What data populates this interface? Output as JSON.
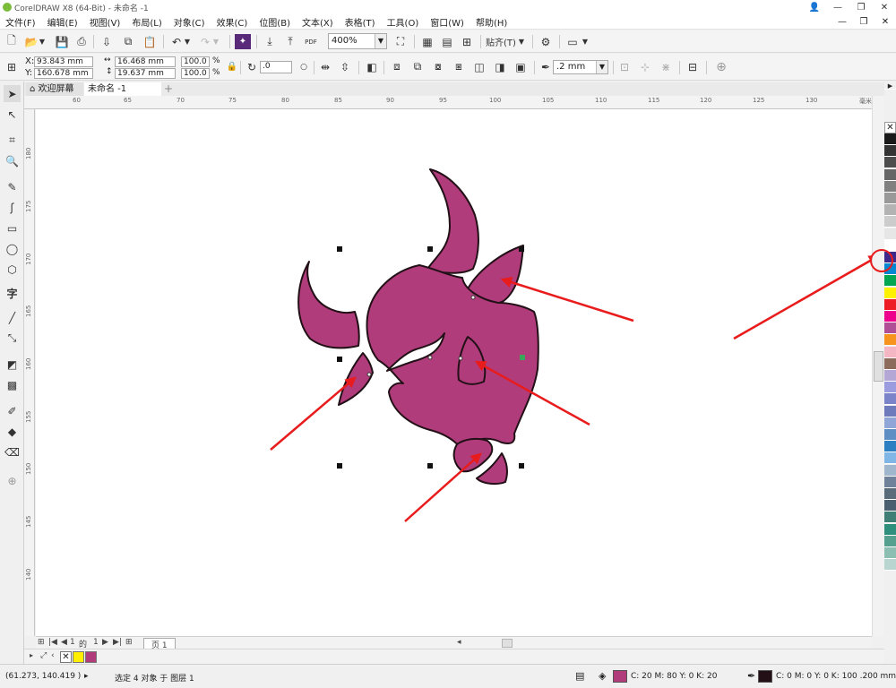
{
  "window": {
    "title": "CorelDRAW X8 (64-Bit) - 未命名 -1"
  },
  "menu": {
    "items": [
      "文件(F)",
      "编辑(E)",
      "视图(V)",
      "布局(L)",
      "对象(C)",
      "效果(C)",
      "位图(B)",
      "文本(X)",
      "表格(T)",
      "工具(O)",
      "窗口(W)",
      "帮助(H)"
    ]
  },
  "toolbar": {
    "zoom": "400%",
    "snap_label": "贴齐(T)",
    "pdf_label": "PDF"
  },
  "propbar": {
    "x_label": "X:",
    "x_value": "93.843 mm",
    "y_label": "Y:",
    "y_value": "160.678 mm",
    "width_value": "16.468 mm",
    "height_value": "19.637 mm",
    "scale_w": "100.0",
    "scale_h": "100.0",
    "percent": "%",
    "angle": ".0",
    "outline_width": ".2 mm"
  },
  "tabs": {
    "welcome": "欢迎屏幕",
    "document": "未命名 -1"
  },
  "ruler": {
    "h_labels": [
      "60",
      "65",
      "70",
      "75",
      "80",
      "85",
      "90",
      "95",
      "100",
      "105",
      "110",
      "115",
      "120",
      "125",
      "130"
    ],
    "v_labels": [
      "180",
      "175",
      "170",
      "165",
      "160",
      "155",
      "150",
      "145",
      "140"
    ],
    "unit": "毫米"
  },
  "pagenav": {
    "current": "1",
    "of": "的",
    "total": "1",
    "page_tab": "页 1"
  },
  "status": {
    "coords": "(61.273, 140.419 )",
    "selection": "选定 4 对象 于 图层 1",
    "fill_info": "C: 20 M: 80 Y: 0 K: 20",
    "outline_info": "C: 0 M: 0 Y: 0 K: 100  .200 mm"
  },
  "colors": {
    "fill": "#b03c7c",
    "outline": "#221016",
    "arrow": "#e81c1c",
    "doc_palette": [
      "#ffffff",
      "#ffee00",
      "#b03c7c"
    ],
    "palette": [
      "#1a1a1a",
      "#333333",
      "#4d4d4d",
      "#666666",
      "#808080",
      "#999999",
      "#b3b3b3",
      "#cccccc",
      "#e6e6e6",
      "#ffffff",
      "#3d2a8a",
      "#0087d1",
      "#00a651",
      "#fff200",
      "#ed1c24",
      "#ec008c",
      "#b04f95",
      "#f7941d",
      "#f4b6c2",
      "#8c6b5d",
      "#b4a7d6",
      "#9b9be0",
      "#7b84c8",
      "#6d7bbd",
      "#8fa6d6",
      "#5e8fc4",
      "#2c7fc1",
      "#7fb6e6",
      "#9fb6cc",
      "#6f8299",
      "#5a6b7a",
      "#4a6070",
      "#3f7f76",
      "#2e8f7c",
      "#55a08e",
      "#8cbfb1",
      "#b8d6cf"
    ]
  }
}
